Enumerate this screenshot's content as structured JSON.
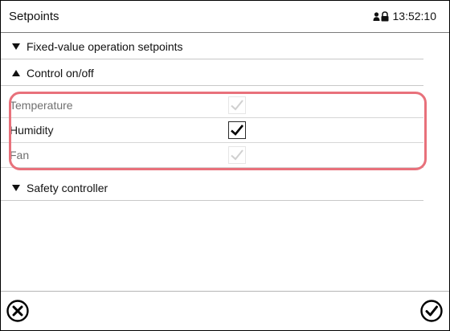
{
  "header": {
    "title": "Setpoints",
    "clock": "13:52:10",
    "lock_icon": "user-lock-icon"
  },
  "sections": [
    {
      "label": "Fixed-value operation setpoints",
      "expanded": false
    },
    {
      "label": "Control on/off",
      "expanded": true
    },
    {
      "label": "Safety controller",
      "expanded": false
    }
  ],
  "control_items": [
    {
      "label": "Temperature",
      "checked": true,
      "enabled": false
    },
    {
      "label": "Humidity",
      "checked": true,
      "enabled": true
    },
    {
      "label": "Fan",
      "checked": true,
      "enabled": false
    }
  ],
  "footer": {
    "cancel_icon": "cancel-circle-x-icon",
    "confirm_icon": "confirm-circle-check-icon"
  },
  "colors": {
    "highlight": "#e8717b",
    "text": "#1a1a1a",
    "disabled_text": "#707070",
    "disabled_check": "#d0d0d0"
  }
}
